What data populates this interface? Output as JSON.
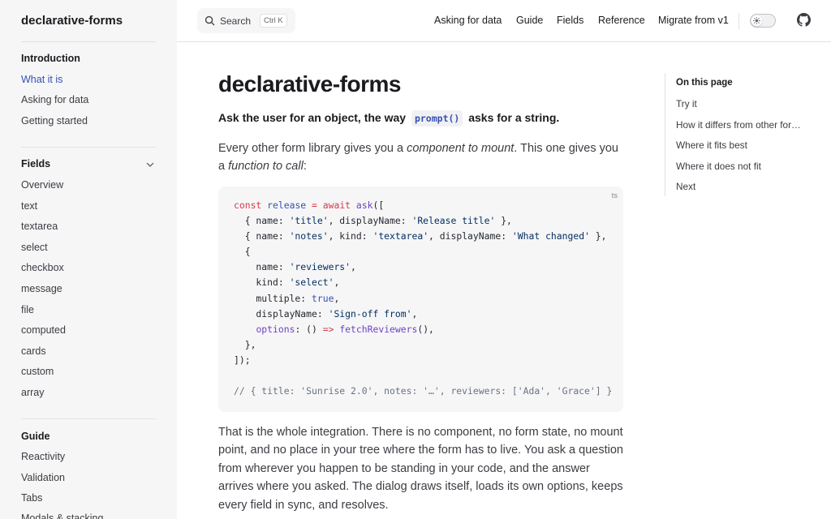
{
  "sidebar": {
    "brand": "declarative-forms",
    "sections": [
      {
        "heading": "Introduction",
        "items": [
          "What it is",
          "Asking for data",
          "Getting started"
        ]
      },
      {
        "heading": "Fields",
        "items": [
          "Overview",
          "text",
          "textarea",
          "select",
          "checkbox",
          "message",
          "file",
          "computed",
          "cards",
          "custom",
          "array"
        ]
      },
      {
        "heading": "Guide",
        "items": [
          "Reactivity",
          "Validation",
          "Tabs",
          "Modals & stacking"
        ]
      }
    ]
  },
  "topbar": {
    "search_label": "Search",
    "search_shortcut": "Ctrl K",
    "nav": [
      "Asking for data",
      "Guide",
      "Fields",
      "Reference",
      "Migrate from v1"
    ]
  },
  "main": {
    "title": "declarative-forms",
    "lead_before": "Ask the user for an object, the way",
    "lead_code": "prompt()",
    "lead_after": "asks for a string.",
    "intro_1": "Every other form library gives you a",
    "intro_em1": "component to mount",
    "intro_2": ". This one gives you a",
    "intro_em2": "function to call",
    "intro_3": ":",
    "code_lang": "ts",
    "code_lines": [
      "const release = await ask([",
      "  { name: 'title', displayName: 'Release title' },",
      "  { name: 'notes', kind: 'textarea', displayName: 'What changed' },",
      "  {",
      "    name: 'reviewers',",
      "    kind: 'select',",
      "    multiple: true,",
      "    displayName: 'Sign-off from',",
      "    options: () => fetchReviewers(),",
      "  },",
      "]);",
      "",
      "// { title: 'Sunrise 2.0', notes: '…', reviewers: ['Ada', 'Grace'] }"
    ],
    "body": "That is the whole integration. There is no component, no form state, no mount point, and no place in your tree where the form has to live. You ask a question from wherever you happen to be standing in your code, and the answer arrives where you asked. The dialog draws itself, loads its own options, keeps every field in sync, and resolves."
  },
  "toc": {
    "title": "On this page",
    "items": [
      "Try it",
      "How it differs from other form libraries",
      "Where it fits best",
      "Where it does not fit",
      "Next"
    ]
  },
  "icons": [
    "search-icon",
    "chevron-down-icon",
    "sun-icon",
    "github-icon"
  ],
  "colors": {
    "accent": "#3451b2",
    "sidebar_bg": "#f6f6f7",
    "code_bg": "#f6f6f7"
  }
}
